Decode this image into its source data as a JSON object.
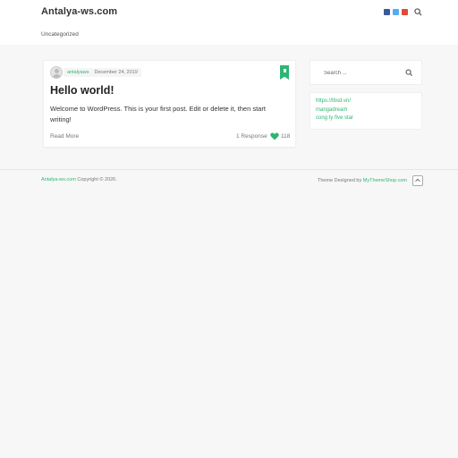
{
  "header": {
    "site_title": "Antalya-ws.com",
    "icons": [
      "facebook-icon",
      "twitter-icon",
      "google-plus-icon",
      "search-icon"
    ]
  },
  "nav": {
    "items": [
      {
        "label": "Uncategorized"
      }
    ]
  },
  "post": {
    "author": "antalyaws",
    "date": "December 24, 2019",
    "title": "Hello world!",
    "excerpt": "Welcome to WordPress. This is your first post. Edit or delete it, then start writing!",
    "read_more": "Read More",
    "responses": "1 Response",
    "likes": "118"
  },
  "sidebar": {
    "search": {
      "placeholder": "Search ..."
    },
    "links": [
      "https://tbsd.vn/",
      "mangadream",
      "cong ty five star"
    ]
  },
  "footer": {
    "site_link": "Antalya-ws.com",
    "copyright": " Copyright © 2026.",
    "theme_prefix": "Theme Designed by ",
    "theme_link": "MyThemeShop.com"
  },
  "colors": {
    "accent": "#2db673",
    "background": "#f7f7f7",
    "card": "#ffffff"
  }
}
